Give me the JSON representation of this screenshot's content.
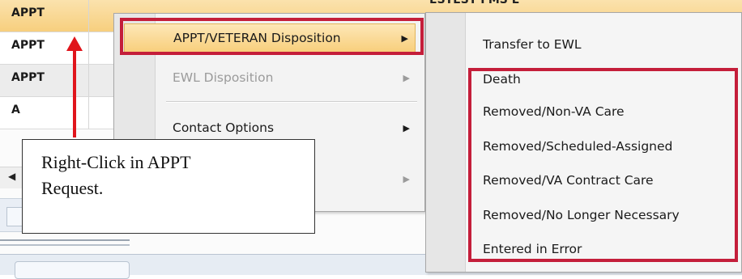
{
  "grid": {
    "rows": [
      {
        "label": "APPT"
      },
      {
        "label": "APPT"
      },
      {
        "label": "APPT"
      },
      {
        "label": "A"
      }
    ],
    "row1_trailing_text": "ESTEST FMS L",
    "scroll_left_glyph": "◀"
  },
  "menu": {
    "items": [
      {
        "label": "APPT/VETERAN Disposition",
        "arrow": "▶"
      },
      {
        "label": "EWL Disposition",
        "arrow": "▶"
      },
      {
        "label": "Contact Options",
        "arrow": "▶"
      },
      {
        "label": "",
        "arrow": "▶"
      }
    ]
  },
  "submenu": {
    "items": [
      {
        "label": "Transfer to EWL"
      },
      {
        "label": "Death"
      },
      {
        "label": "Removed/Non-VA Care"
      },
      {
        "label": "Removed/Scheduled-Assigned"
      },
      {
        "label": "Removed/VA Contract Care"
      },
      {
        "label": "Removed/No Longer Necessary"
      },
      {
        "label": "Entered in Error"
      }
    ]
  },
  "callout": {
    "line1": "Right-Click in APPT",
    "line2": "Request."
  },
  "colors": {
    "highlight_border": "#c41e3a",
    "arrow": "#e0151c",
    "selected_row": "#f8cf7c"
  }
}
